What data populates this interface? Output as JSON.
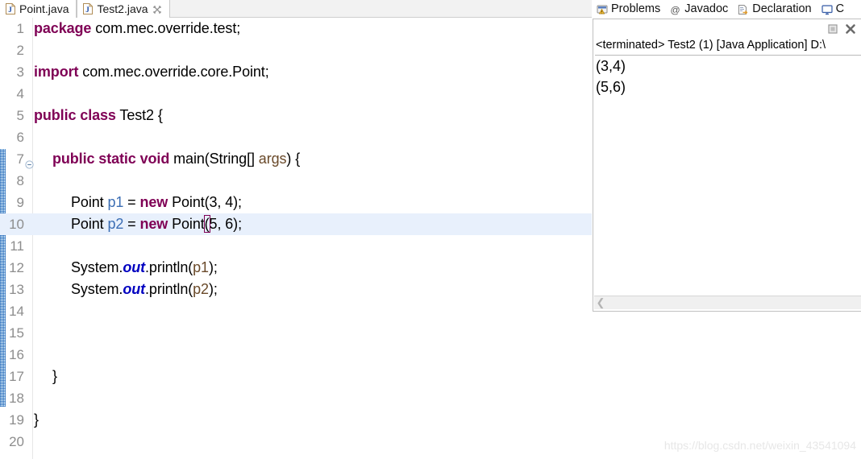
{
  "editor": {
    "tabs": [
      {
        "label": "Point.java",
        "icon": "java-file-icon",
        "active": false,
        "closable": false
      },
      {
        "label": "Test2.java",
        "icon": "java-file-icon",
        "active": true,
        "closable": true
      }
    ],
    "close_icon": "close-icon",
    "current_line": 10,
    "lines": [
      {
        "no": "1",
        "fold": false,
        "indent": 0,
        "tokens": [
          {
            "t": "package",
            "c": "kw"
          },
          {
            "t": " com.mec.override.test;",
            "c": "plain"
          }
        ]
      },
      {
        "no": "2",
        "fold": false,
        "indent": 0,
        "tokens": []
      },
      {
        "no": "3",
        "fold": false,
        "indent": 0,
        "tokens": [
          {
            "t": "import",
            "c": "kw"
          },
          {
            "t": " com.mec.override.core.Point;",
            "c": "plain"
          }
        ]
      },
      {
        "no": "4",
        "fold": false,
        "indent": 0,
        "tokens": []
      },
      {
        "no": "5",
        "fold": false,
        "indent": 0,
        "tokens": [
          {
            "t": "public class",
            "c": "kw"
          },
          {
            "t": " Test2 {",
            "c": "plain"
          }
        ]
      },
      {
        "no": "6",
        "fold": false,
        "indent": 0,
        "tokens": []
      },
      {
        "no": "7",
        "fold": true,
        "indent": 1,
        "tokens": [
          {
            "t": "public static void",
            "c": "kw"
          },
          {
            "t": " main(String[] ",
            "c": "plain"
          },
          {
            "t": "args",
            "c": "parm"
          },
          {
            "t": ") {",
            "c": "plain"
          }
        ]
      },
      {
        "no": "8",
        "fold": false,
        "indent": 0,
        "tokens": []
      },
      {
        "no": "9",
        "fold": false,
        "indent": 2,
        "tokens": [
          {
            "t": "Point ",
            "c": "plain"
          },
          {
            "t": "p1",
            "c": "var"
          },
          {
            "t": " = ",
            "c": "plain"
          },
          {
            "t": "new",
            "c": "kw"
          },
          {
            "t": " Point(3, 4);",
            "c": "plain"
          }
        ]
      },
      {
        "no": "10",
        "fold": false,
        "indent": 2,
        "tokens": [
          {
            "t": "Point ",
            "c": "plain"
          },
          {
            "t": "p2",
            "c": "var"
          },
          {
            "t": " = ",
            "c": "plain"
          },
          {
            "t": "new",
            "c": "kw"
          },
          {
            "t": " Point",
            "c": "plain"
          },
          {
            "t": "(",
            "c": "bracketbox"
          },
          {
            "t": "5, 6);",
            "c": "plain"
          }
        ]
      },
      {
        "no": "11",
        "fold": false,
        "indent": 0,
        "tokens": []
      },
      {
        "no": "12",
        "fold": false,
        "indent": 2,
        "tokens": [
          {
            "t": "System.",
            "c": "plain"
          },
          {
            "t": "out",
            "c": "sfld"
          },
          {
            "t": ".println(",
            "c": "plain"
          },
          {
            "t": "p1",
            "c": "lvar"
          },
          {
            "t": ");",
            "c": "plain"
          }
        ]
      },
      {
        "no": "13",
        "fold": false,
        "indent": 2,
        "tokens": [
          {
            "t": "System.",
            "c": "plain"
          },
          {
            "t": "out",
            "c": "sfld"
          },
          {
            "t": ".println(",
            "c": "plain"
          },
          {
            "t": "p2",
            "c": "lvar"
          },
          {
            "t": ");",
            "c": "plain"
          }
        ]
      },
      {
        "no": "14",
        "fold": false,
        "indent": 0,
        "tokens": []
      },
      {
        "no": "15",
        "fold": false,
        "indent": 0,
        "tokens": []
      },
      {
        "no": "16",
        "fold": false,
        "indent": 0,
        "tokens": []
      },
      {
        "no": "17",
        "fold": false,
        "indent": 1,
        "tokens": [
          {
            "t": "}",
            "c": "plain"
          }
        ]
      },
      {
        "no": "18",
        "fold": false,
        "indent": 0,
        "tokens": []
      },
      {
        "no": "19",
        "fold": false,
        "indent": 0,
        "tokens": [
          {
            "t": "}",
            "c": "plain"
          }
        ]
      },
      {
        "no": "20",
        "fold": false,
        "indent": 0,
        "tokens": []
      }
    ]
  },
  "views": {
    "tabs": [
      {
        "label": "Problems",
        "icon": "problems-icon",
        "active": false
      },
      {
        "label": "Javadoc",
        "icon": "javadoc-at-icon",
        "active": false
      },
      {
        "label": "Declaration",
        "icon": "declaration-icon",
        "active": false
      },
      {
        "label": "C",
        "icon": "console-icon",
        "active": true
      }
    ]
  },
  "console": {
    "toolbar": [
      {
        "name": "terminate-button",
        "icon": "stop-square-icon"
      },
      {
        "name": "remove-launch-button",
        "icon": "close-x-icon"
      }
    ],
    "launch_header": "<terminated> Test2 (1) [Java Application] D:\\",
    "output": [
      "(3,4)",
      "(5,6)"
    ],
    "scroll_left_icon": "chevron-left-icon"
  },
  "watermark": "https://blog.csdn.net/weixin_43541094",
  "colors": {
    "keyword": "#7f0055",
    "static_field": "#0000c0",
    "local_var": "#6a4a2a",
    "field_var": "#3c6eb4",
    "current_line_highlight": "#e8f0fc",
    "change_bar": "#5b9bd5"
  }
}
